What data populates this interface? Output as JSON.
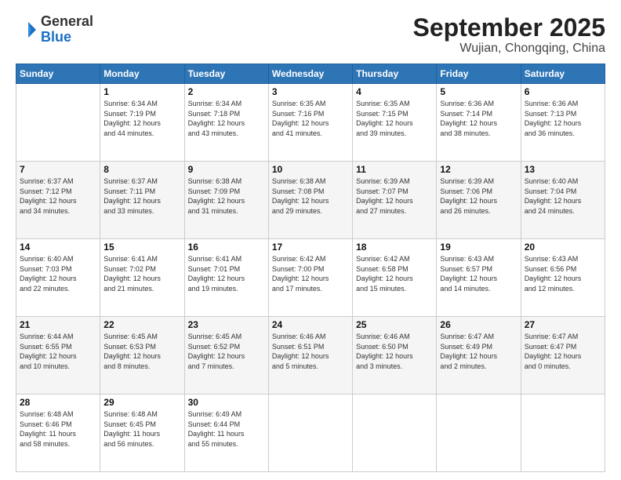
{
  "logo": {
    "general": "General",
    "blue": "Blue"
  },
  "header": {
    "month": "September 2025",
    "location": "Wujian, Chongqing, China"
  },
  "weekdays": [
    "Sunday",
    "Monday",
    "Tuesday",
    "Wednesday",
    "Thursday",
    "Friday",
    "Saturday"
  ],
  "weeks": [
    [
      {
        "day": "",
        "info": ""
      },
      {
        "day": "1",
        "info": "Sunrise: 6:34 AM\nSunset: 7:19 PM\nDaylight: 12 hours\nand 44 minutes."
      },
      {
        "day": "2",
        "info": "Sunrise: 6:34 AM\nSunset: 7:18 PM\nDaylight: 12 hours\nand 43 minutes."
      },
      {
        "day": "3",
        "info": "Sunrise: 6:35 AM\nSunset: 7:16 PM\nDaylight: 12 hours\nand 41 minutes."
      },
      {
        "day": "4",
        "info": "Sunrise: 6:35 AM\nSunset: 7:15 PM\nDaylight: 12 hours\nand 39 minutes."
      },
      {
        "day": "5",
        "info": "Sunrise: 6:36 AM\nSunset: 7:14 PM\nDaylight: 12 hours\nand 38 minutes."
      },
      {
        "day": "6",
        "info": "Sunrise: 6:36 AM\nSunset: 7:13 PM\nDaylight: 12 hours\nand 36 minutes."
      }
    ],
    [
      {
        "day": "7",
        "info": "Sunrise: 6:37 AM\nSunset: 7:12 PM\nDaylight: 12 hours\nand 34 minutes."
      },
      {
        "day": "8",
        "info": "Sunrise: 6:37 AM\nSunset: 7:11 PM\nDaylight: 12 hours\nand 33 minutes."
      },
      {
        "day": "9",
        "info": "Sunrise: 6:38 AM\nSunset: 7:09 PM\nDaylight: 12 hours\nand 31 minutes."
      },
      {
        "day": "10",
        "info": "Sunrise: 6:38 AM\nSunset: 7:08 PM\nDaylight: 12 hours\nand 29 minutes."
      },
      {
        "day": "11",
        "info": "Sunrise: 6:39 AM\nSunset: 7:07 PM\nDaylight: 12 hours\nand 27 minutes."
      },
      {
        "day": "12",
        "info": "Sunrise: 6:39 AM\nSunset: 7:06 PM\nDaylight: 12 hours\nand 26 minutes."
      },
      {
        "day": "13",
        "info": "Sunrise: 6:40 AM\nSunset: 7:04 PM\nDaylight: 12 hours\nand 24 minutes."
      }
    ],
    [
      {
        "day": "14",
        "info": "Sunrise: 6:40 AM\nSunset: 7:03 PM\nDaylight: 12 hours\nand 22 minutes."
      },
      {
        "day": "15",
        "info": "Sunrise: 6:41 AM\nSunset: 7:02 PM\nDaylight: 12 hours\nand 21 minutes."
      },
      {
        "day": "16",
        "info": "Sunrise: 6:41 AM\nSunset: 7:01 PM\nDaylight: 12 hours\nand 19 minutes."
      },
      {
        "day": "17",
        "info": "Sunrise: 6:42 AM\nSunset: 7:00 PM\nDaylight: 12 hours\nand 17 minutes."
      },
      {
        "day": "18",
        "info": "Sunrise: 6:42 AM\nSunset: 6:58 PM\nDaylight: 12 hours\nand 15 minutes."
      },
      {
        "day": "19",
        "info": "Sunrise: 6:43 AM\nSunset: 6:57 PM\nDaylight: 12 hours\nand 14 minutes."
      },
      {
        "day": "20",
        "info": "Sunrise: 6:43 AM\nSunset: 6:56 PM\nDaylight: 12 hours\nand 12 minutes."
      }
    ],
    [
      {
        "day": "21",
        "info": "Sunrise: 6:44 AM\nSunset: 6:55 PM\nDaylight: 12 hours\nand 10 minutes."
      },
      {
        "day": "22",
        "info": "Sunrise: 6:45 AM\nSunset: 6:53 PM\nDaylight: 12 hours\nand 8 minutes."
      },
      {
        "day": "23",
        "info": "Sunrise: 6:45 AM\nSunset: 6:52 PM\nDaylight: 12 hours\nand 7 minutes."
      },
      {
        "day": "24",
        "info": "Sunrise: 6:46 AM\nSunset: 6:51 PM\nDaylight: 12 hours\nand 5 minutes."
      },
      {
        "day": "25",
        "info": "Sunrise: 6:46 AM\nSunset: 6:50 PM\nDaylight: 12 hours\nand 3 minutes."
      },
      {
        "day": "26",
        "info": "Sunrise: 6:47 AM\nSunset: 6:49 PM\nDaylight: 12 hours\nand 2 minutes."
      },
      {
        "day": "27",
        "info": "Sunrise: 6:47 AM\nSunset: 6:47 PM\nDaylight: 12 hours\nand 0 minutes."
      }
    ],
    [
      {
        "day": "28",
        "info": "Sunrise: 6:48 AM\nSunset: 6:46 PM\nDaylight: 11 hours\nand 58 minutes."
      },
      {
        "day": "29",
        "info": "Sunrise: 6:48 AM\nSunset: 6:45 PM\nDaylight: 11 hours\nand 56 minutes."
      },
      {
        "day": "30",
        "info": "Sunrise: 6:49 AM\nSunset: 6:44 PM\nDaylight: 11 hours\nand 55 minutes."
      },
      {
        "day": "",
        "info": ""
      },
      {
        "day": "",
        "info": ""
      },
      {
        "day": "",
        "info": ""
      },
      {
        "day": "",
        "info": ""
      }
    ]
  ]
}
